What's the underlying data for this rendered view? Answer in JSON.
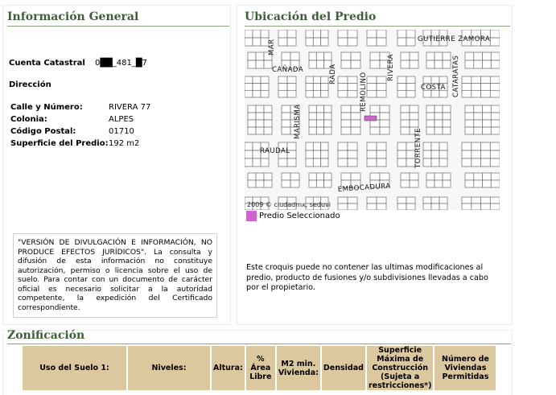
{
  "general": {
    "title": "Información General",
    "cuenta_label": "Cuenta Catastral",
    "cuenta_value": "0██_481_█7",
    "direccion_label": "Dirección",
    "fields": [
      {
        "label": "Calle y Número:",
        "value": "RIVERA 77"
      },
      {
        "label": "Colonia:",
        "value": "ALPES"
      },
      {
        "label": "Código Postal:",
        "value": "01710"
      },
      {
        "label": "Superficie del Predio:",
        "value": "192 m2"
      }
    ],
    "notice": "\"VERSIÓN DE DIVULGACIÓN E INFORMACIÓN, NO PRODUCE EFECTOS JURÍDICOS\". La consulta y difusión de esta información no constituye autorización, permiso o licencia sobre el uso de suelo. Para contar con un documento de carácter oficial es necesario solicitar a la autoridad competente, la expedición del Certificado correspondiente."
  },
  "ubicacion": {
    "title": "Ubicación del Predio",
    "map_credit": "2009 © ciudadmx, seduvi",
    "streets": [
      "GUTIERRE ZAMORA",
      "MAR",
      "CAÑADA",
      "RADA",
      "REMOLINO",
      "RIVERA",
      "COSTA",
      "CATARATAS",
      "MARISMA",
      "RAUDAL",
      "TORRENTE",
      "EMBOCADURA"
    ],
    "legend_label": "Predio Seleccionado",
    "legend_color": "#cc66cc",
    "disclaimer": "Este croquis puede no contener las ultimas modificaciones al predio, producto de fusiones y/o subdivisiones llevadas a cabo por el propietario."
  },
  "zonificacion": {
    "title": "Zonificación",
    "headers": [
      "Uso del Suelo 1:",
      "Niveles:",
      "Altura:",
      "% Área Libre",
      "M2 min. Vivienda:",
      "Densidad",
      "Superficie Máxima de Construcción (Sujeta a restricciones*)",
      "Número de Viviendas Permitidas"
    ]
  },
  "colors": {
    "section_title": "#3f5d3a",
    "header_bg": "#dcc89e"
  }
}
